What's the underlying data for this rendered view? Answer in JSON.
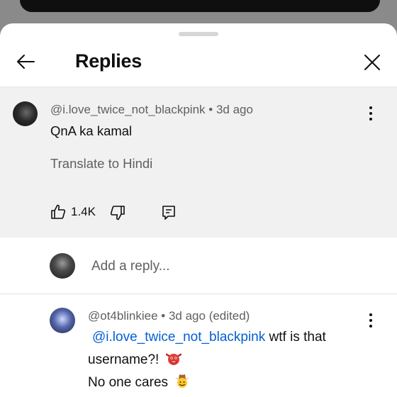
{
  "header": {
    "title": "Replies"
  },
  "parent_comment": {
    "author": "@i.love_twice_not_blackpink",
    "age": "3d ago",
    "text": "QnA ka kamal",
    "translate_label": "Translate to Hindi",
    "like_count": "1.4K"
  },
  "add_reply": {
    "placeholder": "Add a reply..."
  },
  "reply": {
    "author": "@ot4blinkiee",
    "age": "3d ago (edited)",
    "mention": "@i.love_twice_not_blackpink",
    "text_after_mention": "wtf is that",
    "line2": "username?!",
    "line3": "No one cares",
    "emoji1": "goblin-face",
    "emoji2": "cowboy-face"
  },
  "colors": {
    "link": "#065fd4",
    "secondary_text": "#606060",
    "parent_bg": "#f1f1f1"
  }
}
